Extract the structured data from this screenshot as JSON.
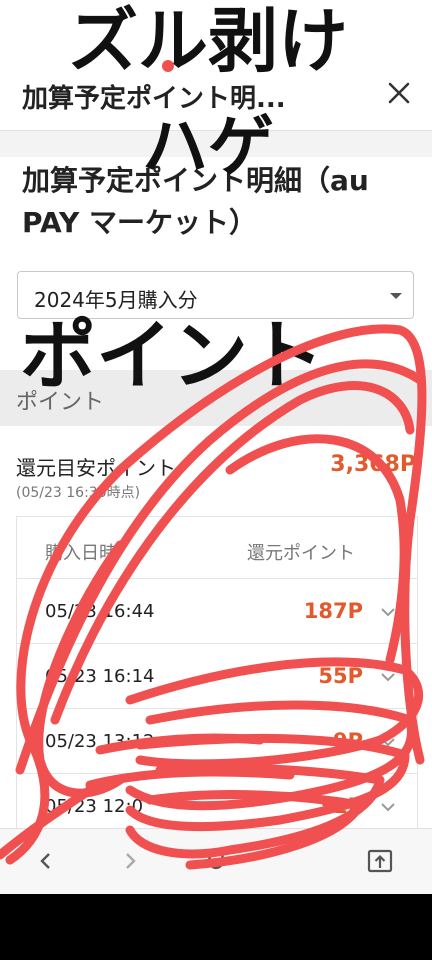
{
  "header": {
    "title": "加算予定ポイント明...",
    "close_icon": "close-icon"
  },
  "page_title": "加算予定ポイント明細（au PAY マーケット）",
  "period_select": {
    "value": "2024年5月購入分"
  },
  "section": {
    "label": "ポイント"
  },
  "summary": {
    "label": "還元目安ポイント",
    "sub": "(05/23 16:30時点)",
    "value": "3,368P"
  },
  "table": {
    "columns": [
      "購入日時",
      "還元ポイント"
    ],
    "rows": [
      {
        "date": "05/23 16:44",
        "points": "187P"
      },
      {
        "date": "05/23 16:14",
        "points": "55P"
      },
      {
        "date": "05/23 13:12",
        "points": "9P"
      },
      {
        "date": "05/23 12:0",
        "points": "31P"
      }
    ]
  },
  "toolbar": {
    "back_icon": "chevron-left-icon",
    "forward_icon": "chevron-right-icon",
    "reload_icon": "reload-icon",
    "share_icon": "share-icon"
  },
  "overlay": {
    "line1": "ズル剥け",
    "line2": "ハゲ",
    "line3": "ポイント",
    "scribble_color": "#f05050"
  },
  "colors": {
    "accent": "#e2592b",
    "scribble": "#f05050"
  }
}
